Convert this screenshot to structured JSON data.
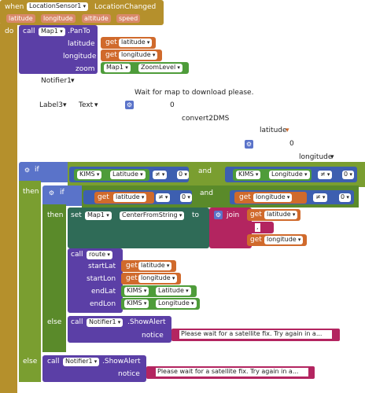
{
  "event": {
    "when": "when",
    "component": "LocationSensor1",
    "event": "LocationChanged",
    "params": [
      "latitude",
      "longitude",
      "altitude",
      "speed"
    ],
    "do": "do"
  },
  "pan": {
    "call": "call",
    "component": "Map1",
    "method": ".PanTo",
    "args": [
      "latitude",
      "longitude",
      "zoom"
    ],
    "get": "get",
    "lat": "latitude",
    "lon": "longitude",
    "zoom_comp": "Map1",
    "zoom_prop": "ZoomLevel"
  },
  "floating": {
    "notifier": "Notifier1",
    "label3": "Label3",
    "text_prop": "Text",
    "wait_msg": "Wait for map to download please.",
    "zero1": "0",
    "convert": "convert2DMS",
    "latitude": "latitude",
    "zero2": "0",
    "longitude": "longitude"
  },
  "if1": {
    "if": "if",
    "then": "then",
    "else": "else",
    "kims": "KIMS",
    "lat_prop": "Latitude",
    "lon_prop": "Longitude",
    "neq": "≠",
    "zero": "0",
    "and": "and"
  },
  "if2": {
    "if": "if",
    "then": "then",
    "else": "else",
    "get": "get",
    "lat": "latitude",
    "lon": "longitude",
    "neq": "≠",
    "zero": "0",
    "and": "and"
  },
  "setmap": {
    "set": "set",
    "component": "Map1",
    "prop": "CenterFromString",
    "to": "to",
    "join": "join",
    "get": "get",
    "lat": "latitude",
    "lon": "longitude",
    "comma": ","
  },
  "route": {
    "call": "call",
    "proc": "route",
    "startLat": "startLat",
    "startLon": "startLon",
    "endLat": "endLat",
    "endLon": "endLon",
    "get": "get",
    "lat": "latitude",
    "lon": "longitude",
    "kims": "KIMS",
    "lat_prop": "Latitude",
    "lon_prop": "Longitude"
  },
  "alert1": {
    "call": "call",
    "component": "Notifier1",
    "method": ".ShowAlert",
    "notice": "notice",
    "msg": "Please wait for a satellite fix.  Try again in a..."
  },
  "alert2": {
    "call": "call",
    "component": "Notifier1",
    "method": ".ShowAlert",
    "notice": "notice",
    "msg": "Please wait for a satellite fix.  Try again in a..."
  }
}
